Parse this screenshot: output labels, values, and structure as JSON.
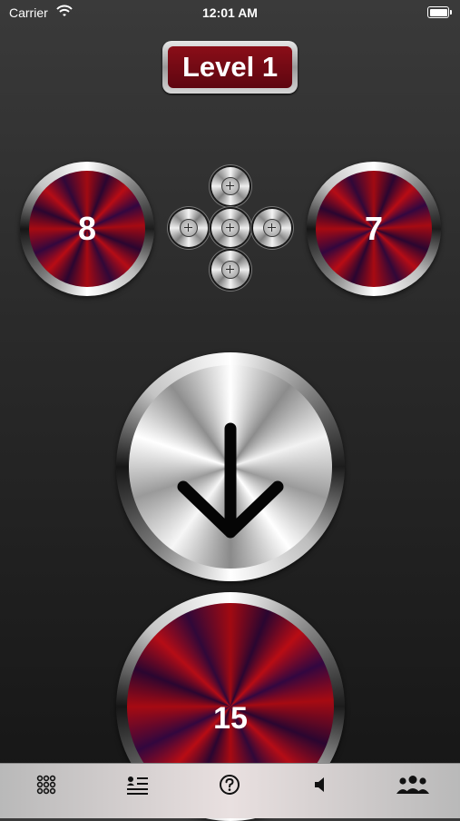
{
  "status_bar": {
    "carrier": "Carrier",
    "time": "12:01 AM"
  },
  "level": {
    "label": "Level 1"
  },
  "counters": {
    "left_value": "8",
    "right_value": "7",
    "bottom_value": "15"
  },
  "icons": {
    "wifi": "wifi-icon",
    "battery": "battery-icon",
    "plus": "plus-icon",
    "arrow": "arrow-down-icon",
    "tabs": [
      "grid-icon",
      "list-icon",
      "help-icon",
      "sound-icon",
      "people-icon"
    ]
  },
  "colors": {
    "accent_red": "#8a0e18",
    "metal": "#c0c0c0"
  }
}
